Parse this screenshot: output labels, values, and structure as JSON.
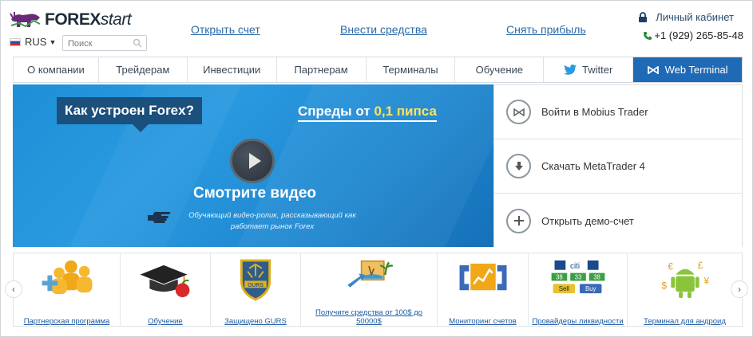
{
  "header": {
    "logo_bold": "FOREX",
    "logo_italic": "start",
    "language": "RUS",
    "search_placeholder": "Поиск",
    "links": [
      "Открыть счет",
      "Внести средства",
      "Снять прибыль"
    ],
    "cabinet": "Личный кабинет",
    "phone": "+1 (929) 265-85-48"
  },
  "nav": {
    "items": [
      "О компании",
      "Трейдерам",
      "Инвестиции",
      "Партнерам",
      "Терминалы",
      "Обучение"
    ],
    "twitter": "Twitter",
    "web_terminal": "Web Terminal"
  },
  "hero": {
    "question": "Как устроен Forex?",
    "spreads_prefix": "Спреды от ",
    "spreads_value": "0,1 пипса",
    "watch": "Смотрите видео",
    "description": "Обучающий видео-ролик, рассказывающий как работает рынок Forex"
  },
  "side": {
    "items": [
      "Войти в Mobius Trader",
      "Скачать MetaTrader 4",
      "Открыть демо-счет"
    ]
  },
  "carousel": {
    "items": [
      "Партнерская программа",
      "Обучение",
      "Защищено GURS",
      "Получите средства от 100$ до 50000$",
      "Мониторинг счетов",
      "Провайдеры ликвидности",
      "Терминал для андроид"
    ],
    "badge_text": "GURS",
    "liquidity_tiles": [
      "citi",
      "38",
      "33",
      "38",
      "Sell",
      "Buy"
    ]
  },
  "colors": {
    "accent": "#1f6ab6",
    "link": "#2a6aa8",
    "hero_bg": "#1e8fd6",
    "question_box": "#1b4f7c"
  }
}
